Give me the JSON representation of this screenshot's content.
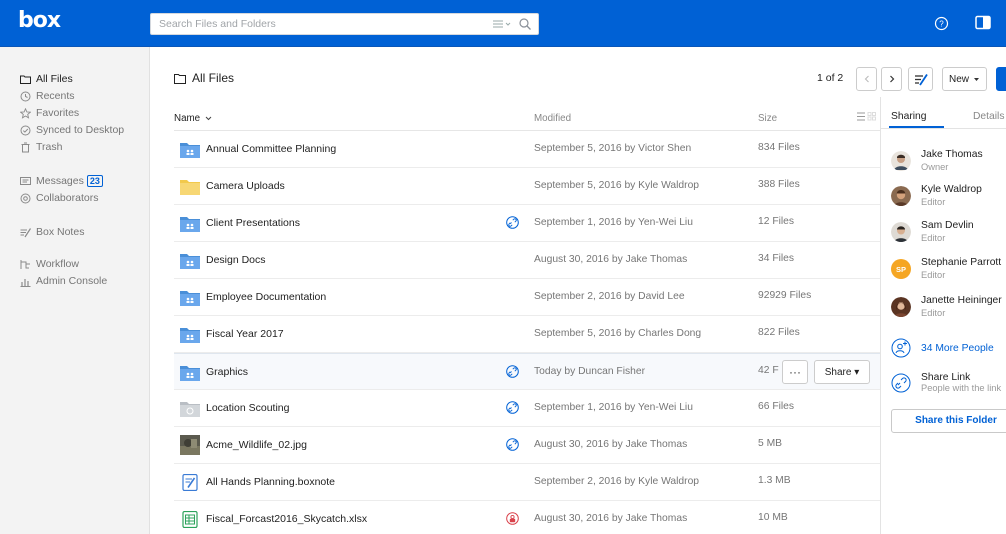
{
  "header": {
    "logo_text": "box",
    "search_placeholder": "Search Files and Folders",
    "accent_color": "#0061d5"
  },
  "sidebar": {
    "items": [
      {
        "label": "All Files",
        "icon": "folder-icon",
        "active": true
      },
      {
        "label": "Recents",
        "icon": "clock-icon"
      },
      {
        "label": "Favorites",
        "icon": "star-icon"
      },
      {
        "label": "Synced to Desktop",
        "icon": "check-circle-icon"
      },
      {
        "label": "Trash",
        "icon": "trash-icon"
      },
      {
        "label": "Messages",
        "icon": "message-icon",
        "badge": "23"
      },
      {
        "label": "Collaborators",
        "icon": "at-icon"
      },
      {
        "label": "Box Notes",
        "icon": "notes-icon"
      },
      {
        "label": "Workflow",
        "icon": "workflow-icon"
      },
      {
        "label": "Admin Console",
        "icon": "chart-icon"
      }
    ]
  },
  "main": {
    "title": "All Files",
    "pagination": "1 of 2",
    "new_button": "New",
    "columns": {
      "name": "Name",
      "modified": "Modified",
      "size": "Size"
    },
    "rows": [
      {
        "name": "Annual Committee Planning",
        "icon": "shared-folder-icon",
        "modified": "September 5, 2016 by Victor Shen",
        "size": "834 Files"
      },
      {
        "name": "Camera Uploads",
        "icon": "folder-icon",
        "modified": "September 5, 2016 by Kyle Waldrop",
        "size": "388 Files"
      },
      {
        "name": "Client Presentations",
        "icon": "shared-folder-icon",
        "collab": "link-icon",
        "modified": "September 1, 2016 by Yen-Wei Liu",
        "size": "12 Files"
      },
      {
        "name": "Design Docs",
        "icon": "shared-folder-icon",
        "modified": "August 30, 2016 by Jake Thomas",
        "size": "34 Files"
      },
      {
        "name": "Employee Documentation",
        "icon": "shared-folder-icon",
        "modified": "September 2, 2016 by David Lee",
        "size": "92929 Files"
      },
      {
        "name": "Fiscal Year 2017",
        "icon": "shared-folder-icon",
        "modified": "September 5, 2016 by Charles Dong",
        "size": "822 Files"
      },
      {
        "name": "Graphics",
        "icon": "shared-folder-icon",
        "collab": "link-icon",
        "modified": "Today by Duncan Fisher",
        "size": "42 F",
        "hover": true,
        "more_label": "···",
        "share_label": "Share ▾"
      },
      {
        "name": "Location Scouting",
        "icon": "synced-folder-icon",
        "collab": "link-icon",
        "modified": "September 1, 2016 by Yen-Wei Liu",
        "size": "66 Files"
      },
      {
        "name": "Acme_Wildlife_02.jpg",
        "icon": "image-thumbnail-icon",
        "collab": "link-icon",
        "modified": "August 30, 2016 by Jake Thomas",
        "size": "5 MB"
      },
      {
        "name": "All Hands Planning.boxnote",
        "icon": "boxnote-icon",
        "modified": "September 2, 2016 by Kyle Waldrop",
        "size": "1.3 MB"
      },
      {
        "name": "Fiscal_Forcast2016_Skycatch.xlsx",
        "icon": "spreadsheet-icon",
        "collab": "restricted-icon",
        "modified": "August 30, 2016 by Jake Thomas",
        "size": "10 MB"
      }
    ]
  },
  "rightpanel": {
    "tab_sharing": "Sharing",
    "tab_details": "Details",
    "people": [
      {
        "name": "Jake Thomas",
        "role": "Owner"
      },
      {
        "name": "Kyle Waldrop",
        "role": "Editor"
      },
      {
        "name": "Sam Devlin",
        "role": "Editor"
      },
      {
        "name": "Stephanie Parrott",
        "role": "Editor",
        "initials": "SP"
      },
      {
        "name": "Janette Heininger",
        "role": "Editor"
      }
    ],
    "more_people": "34 More People",
    "share_link_title": "Share Link",
    "share_link_desc": "People with the link",
    "share_folder_button": "Share this Folder"
  }
}
